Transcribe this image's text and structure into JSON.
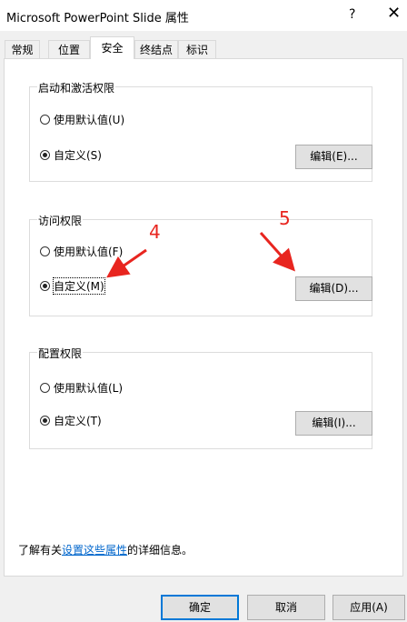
{
  "window": {
    "title": "Microsoft PowerPoint Slide 属性",
    "help_label": "?",
    "close_label": "✕"
  },
  "tabs": [
    {
      "label": "常规",
      "active": false
    },
    {
      "label": "位置",
      "active": false
    },
    {
      "label": "安全",
      "active": true
    },
    {
      "label": "终结点",
      "active": false
    },
    {
      "label": "标识",
      "active": false
    }
  ],
  "groups": {
    "launch": {
      "title": "启动和激活权限",
      "default_label": "使用默认值(U)",
      "custom_label": "自定义(S)",
      "edit_label": "编辑(E)...",
      "selected": "custom"
    },
    "access": {
      "title": "访问权限",
      "default_label": "使用默认值(F)",
      "custom_label": "自定义(M)",
      "edit_label": "编辑(D)...",
      "selected": "custom"
    },
    "config": {
      "title": "配置权限",
      "default_label": "使用默认值(L)",
      "custom_label": "自定义(T)",
      "edit_label": "编辑(I)...",
      "selected": "custom"
    }
  },
  "annotations": {
    "marker_4": "4",
    "marker_5": "5",
    "color": "#e8251f"
  },
  "info": {
    "prefix": "了解有关",
    "link": "设置这些属性",
    "suffix": "的详细信息。"
  },
  "buttons": {
    "ok": "确定",
    "cancel": "取消",
    "apply": "应用(A)"
  }
}
